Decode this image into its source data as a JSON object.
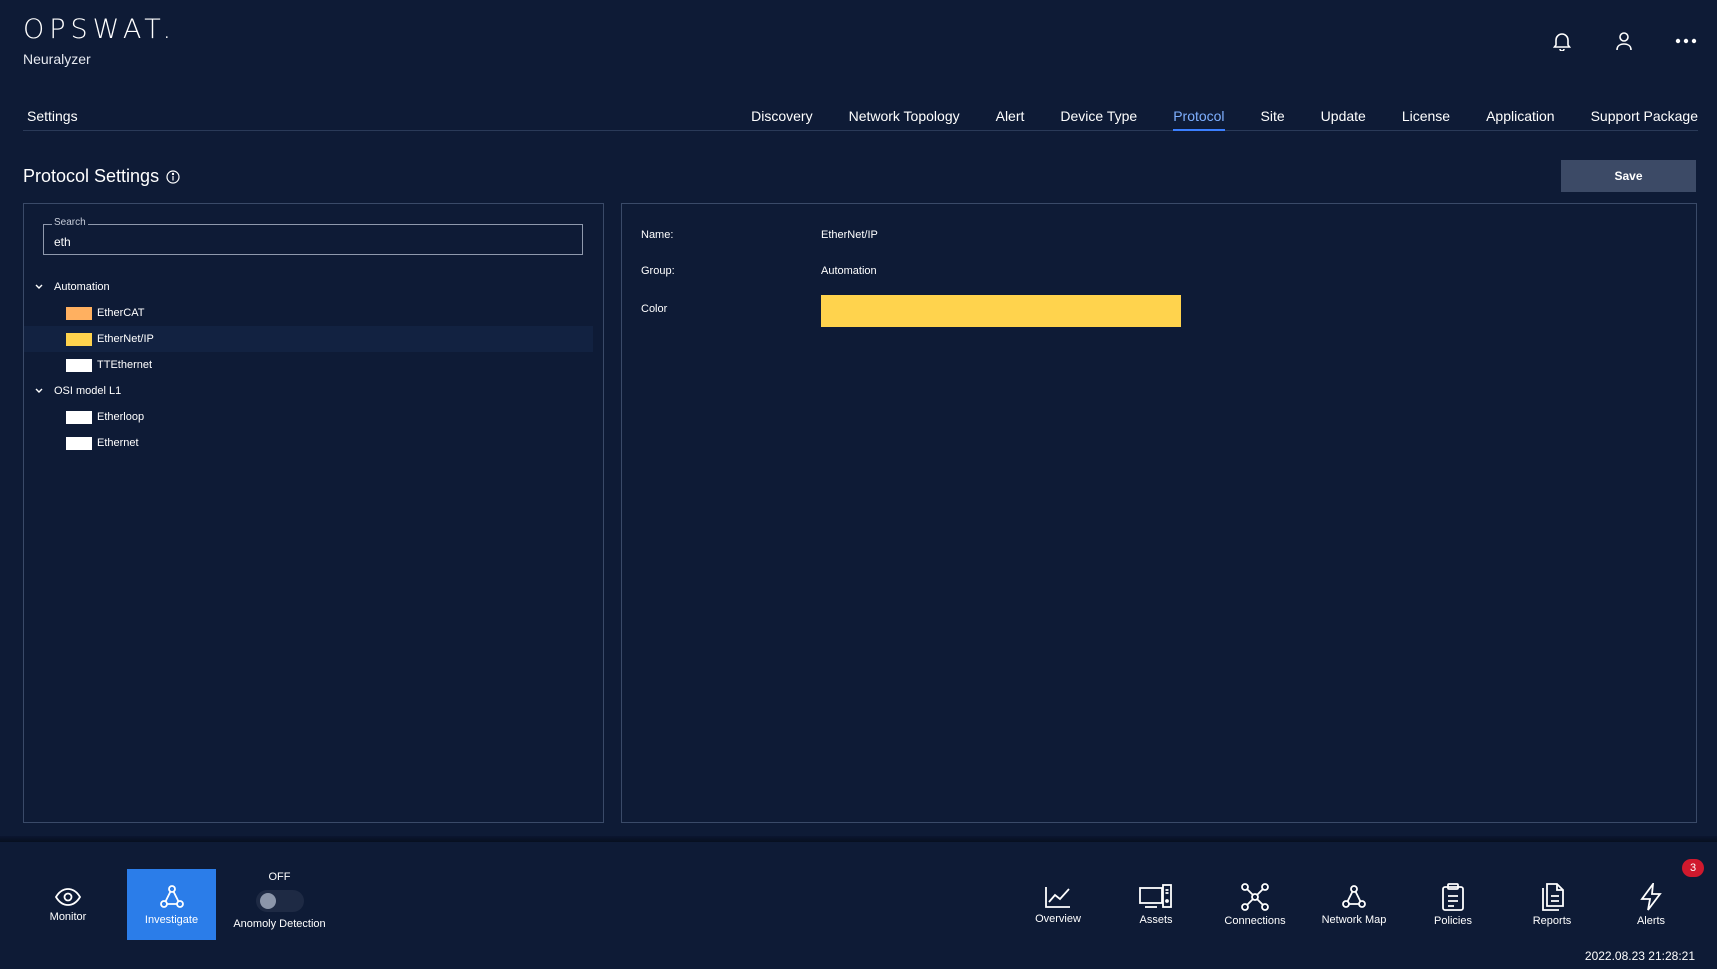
{
  "brand": {
    "logo": "OPSWAT.",
    "product": "Neuralyzer"
  },
  "header_icons": [
    "bell-icon",
    "user-icon",
    "more-icon"
  ],
  "settings_label": "Settings",
  "tabs": [
    "Discovery",
    "Network Topology",
    "Alert",
    "Device Type",
    "Protocol",
    "Site",
    "Update",
    "License",
    "Application",
    "Support Package"
  ],
  "active_tab": "Protocol",
  "section": {
    "title": "Protocol Settings",
    "save_label": "Save"
  },
  "search": {
    "legend": "Search",
    "value": "eth"
  },
  "tree": [
    {
      "group": "Automation",
      "items": [
        {
          "label": "EtherCAT",
          "color": "#ffb060"
        },
        {
          "label": "EtherNet/IP",
          "color": "#ffd34d",
          "selected": true
        },
        {
          "label": "TTEthernet",
          "color": "#ffffff"
        }
      ]
    },
    {
      "group": "OSI model L1",
      "items": [
        {
          "label": "Etherloop",
          "color": "#ffffff"
        },
        {
          "label": "Ethernet",
          "color": "#ffffff"
        }
      ]
    }
  ],
  "detail": {
    "name_label": "Name:",
    "name_value": "EtherNet/IP",
    "group_label": "Group:",
    "group_value": "Automation",
    "color_label": "Color",
    "color_value": "#ffd34d"
  },
  "bottom_nav": {
    "left": [
      {
        "label": "Monitor",
        "icon": "eye-icon",
        "active": false
      },
      {
        "label": "Investigate",
        "icon": "investigate-icon",
        "active": true
      }
    ],
    "anomaly": {
      "state": "OFF",
      "label": "Anomoly Detection"
    },
    "right": [
      {
        "label": "Overview",
        "icon": "chart-icon"
      },
      {
        "label": "Assets",
        "icon": "devices-icon"
      },
      {
        "label": "Connections",
        "icon": "connections-icon"
      },
      {
        "label": "Network Map",
        "icon": "network-map-icon"
      },
      {
        "label": "Policies",
        "icon": "clipboard-icon"
      },
      {
        "label": "Reports",
        "icon": "reports-icon"
      },
      {
        "label": "Alerts",
        "icon": "lightning-icon"
      }
    ],
    "alerts_badge": "3"
  },
  "timestamp": "2022.08.23 21:28:21",
  "colors": {
    "background": "#0e1b36",
    "accent": "#2b7de9",
    "badge": "#d0192d"
  }
}
